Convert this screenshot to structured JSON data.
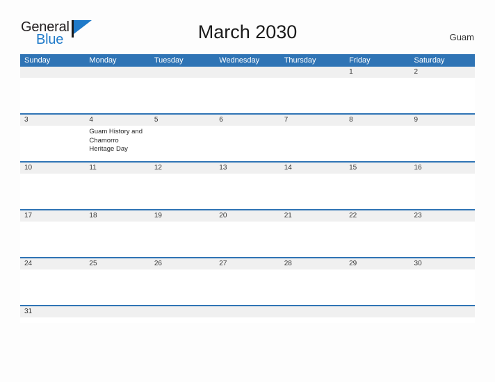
{
  "brand": {
    "name_part1": "General",
    "name_part2": "Blue",
    "flag_icon": "blue-flag-triangle",
    "color_dark": "#231f20",
    "color_blue": "#1f7ac9"
  },
  "header": {
    "title": "March 2030",
    "region": "Guam"
  },
  "theme": {
    "header_blue": "#2f74b5",
    "band_gray": "#f0f0f0",
    "divider_blue": "#2f74b5",
    "page_background": "#fdfdfd"
  },
  "weekdays": [
    "Sunday",
    "Monday",
    "Tuesday",
    "Wednesday",
    "Thursday",
    "Friday",
    "Saturday"
  ],
  "weeks": [
    {
      "days": [
        {
          "num": "",
          "event": ""
        },
        {
          "num": "",
          "event": ""
        },
        {
          "num": "",
          "event": ""
        },
        {
          "num": "",
          "event": ""
        },
        {
          "num": "",
          "event": ""
        },
        {
          "num": "1",
          "event": ""
        },
        {
          "num": "2",
          "event": ""
        }
      ]
    },
    {
      "days": [
        {
          "num": "3",
          "event": ""
        },
        {
          "num": "4",
          "event": "Guam History and Chamorro Heritage Day"
        },
        {
          "num": "5",
          "event": ""
        },
        {
          "num": "6",
          "event": ""
        },
        {
          "num": "7",
          "event": ""
        },
        {
          "num": "8",
          "event": ""
        },
        {
          "num": "9",
          "event": ""
        }
      ]
    },
    {
      "days": [
        {
          "num": "10",
          "event": ""
        },
        {
          "num": "11",
          "event": ""
        },
        {
          "num": "12",
          "event": ""
        },
        {
          "num": "13",
          "event": ""
        },
        {
          "num": "14",
          "event": ""
        },
        {
          "num": "15",
          "event": ""
        },
        {
          "num": "16",
          "event": ""
        }
      ]
    },
    {
      "days": [
        {
          "num": "17",
          "event": ""
        },
        {
          "num": "18",
          "event": ""
        },
        {
          "num": "19",
          "event": ""
        },
        {
          "num": "20",
          "event": ""
        },
        {
          "num": "21",
          "event": ""
        },
        {
          "num": "22",
          "event": ""
        },
        {
          "num": "23",
          "event": ""
        }
      ]
    },
    {
      "days": [
        {
          "num": "24",
          "event": ""
        },
        {
          "num": "25",
          "event": ""
        },
        {
          "num": "26",
          "event": ""
        },
        {
          "num": "27",
          "event": ""
        },
        {
          "num": "28",
          "event": ""
        },
        {
          "num": "29",
          "event": ""
        },
        {
          "num": "30",
          "event": ""
        }
      ]
    },
    {
      "days": [
        {
          "num": "31",
          "event": ""
        },
        {
          "num": "",
          "event": ""
        },
        {
          "num": "",
          "event": ""
        },
        {
          "num": "",
          "event": ""
        },
        {
          "num": "",
          "event": ""
        },
        {
          "num": "",
          "event": ""
        },
        {
          "num": "",
          "event": ""
        }
      ]
    }
  ]
}
